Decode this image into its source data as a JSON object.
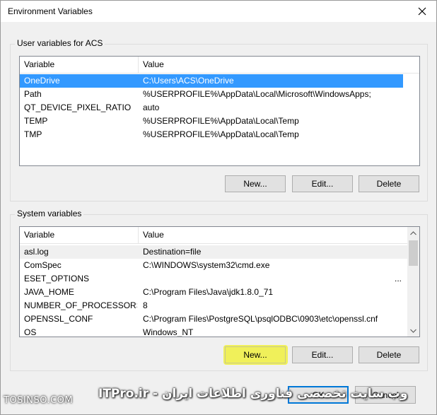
{
  "window": {
    "title": "Environment Variables"
  },
  "user_vars": {
    "label": "User variables for ACS",
    "columns": [
      "Variable",
      "Value"
    ],
    "rows": [
      {
        "variable": "OneDrive",
        "value": "C:\\Users\\ACS\\OneDrive"
      },
      {
        "variable": "Path",
        "value": "%USERPROFILE%\\AppData\\Local\\Microsoft\\WindowsApps;"
      },
      {
        "variable": "QT_DEVICE_PIXEL_RATIO",
        "value": "auto"
      },
      {
        "variable": "TEMP",
        "value": "%USERPROFILE%\\AppData\\Local\\Temp"
      },
      {
        "variable": "TMP",
        "value": "%USERPROFILE%\\AppData\\Local\\Temp"
      }
    ],
    "selected_index": 0,
    "buttons": {
      "new": "New...",
      "edit": "Edit...",
      "delete": "Delete"
    }
  },
  "system_vars": {
    "label": "System variables",
    "columns": [
      "Variable",
      "Value"
    ],
    "rows": [
      {
        "variable": "asl.log",
        "value": "Destination=file"
      },
      {
        "variable": "ComSpec",
        "value": "C:\\WINDOWS\\system32\\cmd.exe"
      },
      {
        "variable": "ESET_OPTIONS",
        "value": "",
        "ellipsis": "..."
      },
      {
        "variable": "JAVA_HOME",
        "value": "C:\\Program Files\\Java\\jdk1.8.0_71"
      },
      {
        "variable": "NUMBER_OF_PROCESSORS",
        "value": "8"
      },
      {
        "variable": "OPENSSL_CONF",
        "value": "C:\\Program Files\\PostgreSQL\\psqlODBC\\0903\\etc\\openssl.cnf"
      },
      {
        "variable": "OS",
        "value": "Windows_NT"
      }
    ],
    "highlighted_index": 0,
    "buttons": {
      "new": "New...",
      "edit": "Edit...",
      "delete": "Delete"
    }
  },
  "footer": {
    "ok": "OK",
    "cancel": "Cancel"
  },
  "watermark": {
    "left": "TOSINSO.COM",
    "right": "وب سایت تخصصی فناوری اطلاعات ایران - ITPro.ir"
  },
  "colors": {
    "selection": "#3399ff",
    "highlight_marker": "#f0f028",
    "default_button_border": "#0078d7"
  },
  "icons": {
    "close": "close-icon",
    "scroll_up": "chevron-up-icon",
    "scroll_down": "chevron-down-icon"
  }
}
